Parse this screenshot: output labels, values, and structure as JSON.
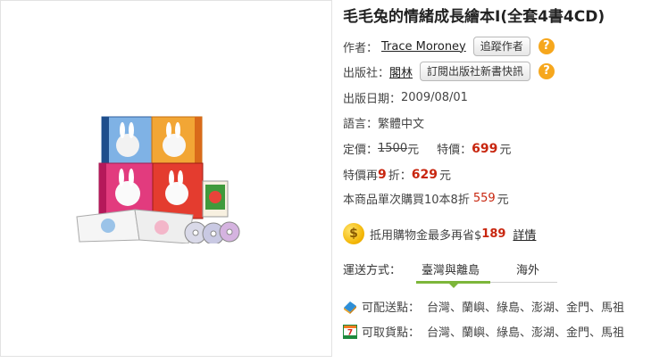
{
  "product": {
    "title": "毛毛兔的情緒成長繪本I(全套4書4CD)",
    "author_label": "作者：",
    "author": "Trace Moroney",
    "follow_author_button": "追蹤作者",
    "publisher_label": "出版社：",
    "publisher": "閣林",
    "subscribe_publisher_button": "訂閱出版社新書快訊",
    "date_label": "出版日期：",
    "date": "2009/08/01",
    "language_label": "語言：",
    "language": "繁體中文"
  },
  "pricing": {
    "list_label": "定價：",
    "list_price": "1500",
    "yuan": "元",
    "special_label": "特價：",
    "special_price": "699",
    "again_label": "特價再",
    "again_discount": "9",
    "again_zhe": "折：",
    "again_price": "629",
    "bulk_text": "本商品單次購買10本8折",
    "bulk_price": "559"
  },
  "points": {
    "coin_symbol": "$",
    "text": "抵用購物金最多再省$",
    "amount": "189",
    "details_link": "詳情"
  },
  "shipping": {
    "label": "運送方式：",
    "tabs": [
      "臺灣與離島",
      "海外"
    ],
    "delivery_label": "可配送點：",
    "delivery_places": "台灣、蘭嶼、綠島、澎湖、金門、馬祖",
    "pickup_label": "可取貨點：",
    "pickup_places": "台灣、蘭嶼、綠島、澎湖、金門、馬祖"
  },
  "icons": {
    "help": "question-circle-icon",
    "coin": "coin-icon",
    "delivery": "delivery-truck-icon",
    "pickup": "seven-eleven-icon"
  },
  "colors": {
    "price_red": "#c8260f",
    "help_orange": "#f6a71d",
    "tab_green": "#7db63a"
  }
}
